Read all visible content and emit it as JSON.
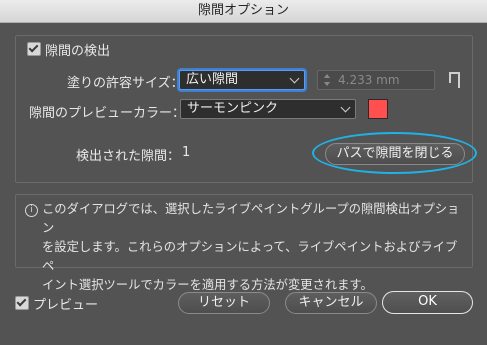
{
  "window": {
    "title": "隙間オプション"
  },
  "gap_detection": {
    "checkbox_label": "隙間の検出",
    "checked": true,
    "fill_gap_label": "塗りの許容サイズ：",
    "fill_gap_value": "広い隙間",
    "custom_value": "4.233 mm",
    "preview_color_label": "隙間のプレビューカラー：",
    "preview_color_value": "サーモンピンク",
    "preview_color_swatch": "#ff4f4f",
    "detected_label": "検出された隙間：",
    "detected_count": "1",
    "close_gaps_button": "パスで隙間を閉じる",
    "highlight_ring_color": "#1fb2e6"
  },
  "info": {
    "icon": "info-icon",
    "lines": [
      "このダイアログでは、選択したライブペイントグループの隙間検出オプション",
      "を設定します。これらのオプションによって、ライブペイントおよびライブペ",
      "イント選択ツールでカラーを適用する方法が変更されます。"
    ]
  },
  "footer": {
    "preview_label": "プレビュー",
    "preview_checked": true,
    "reset_button": "リセット",
    "cancel_button": "キャンセル",
    "ok_button": "OK"
  }
}
